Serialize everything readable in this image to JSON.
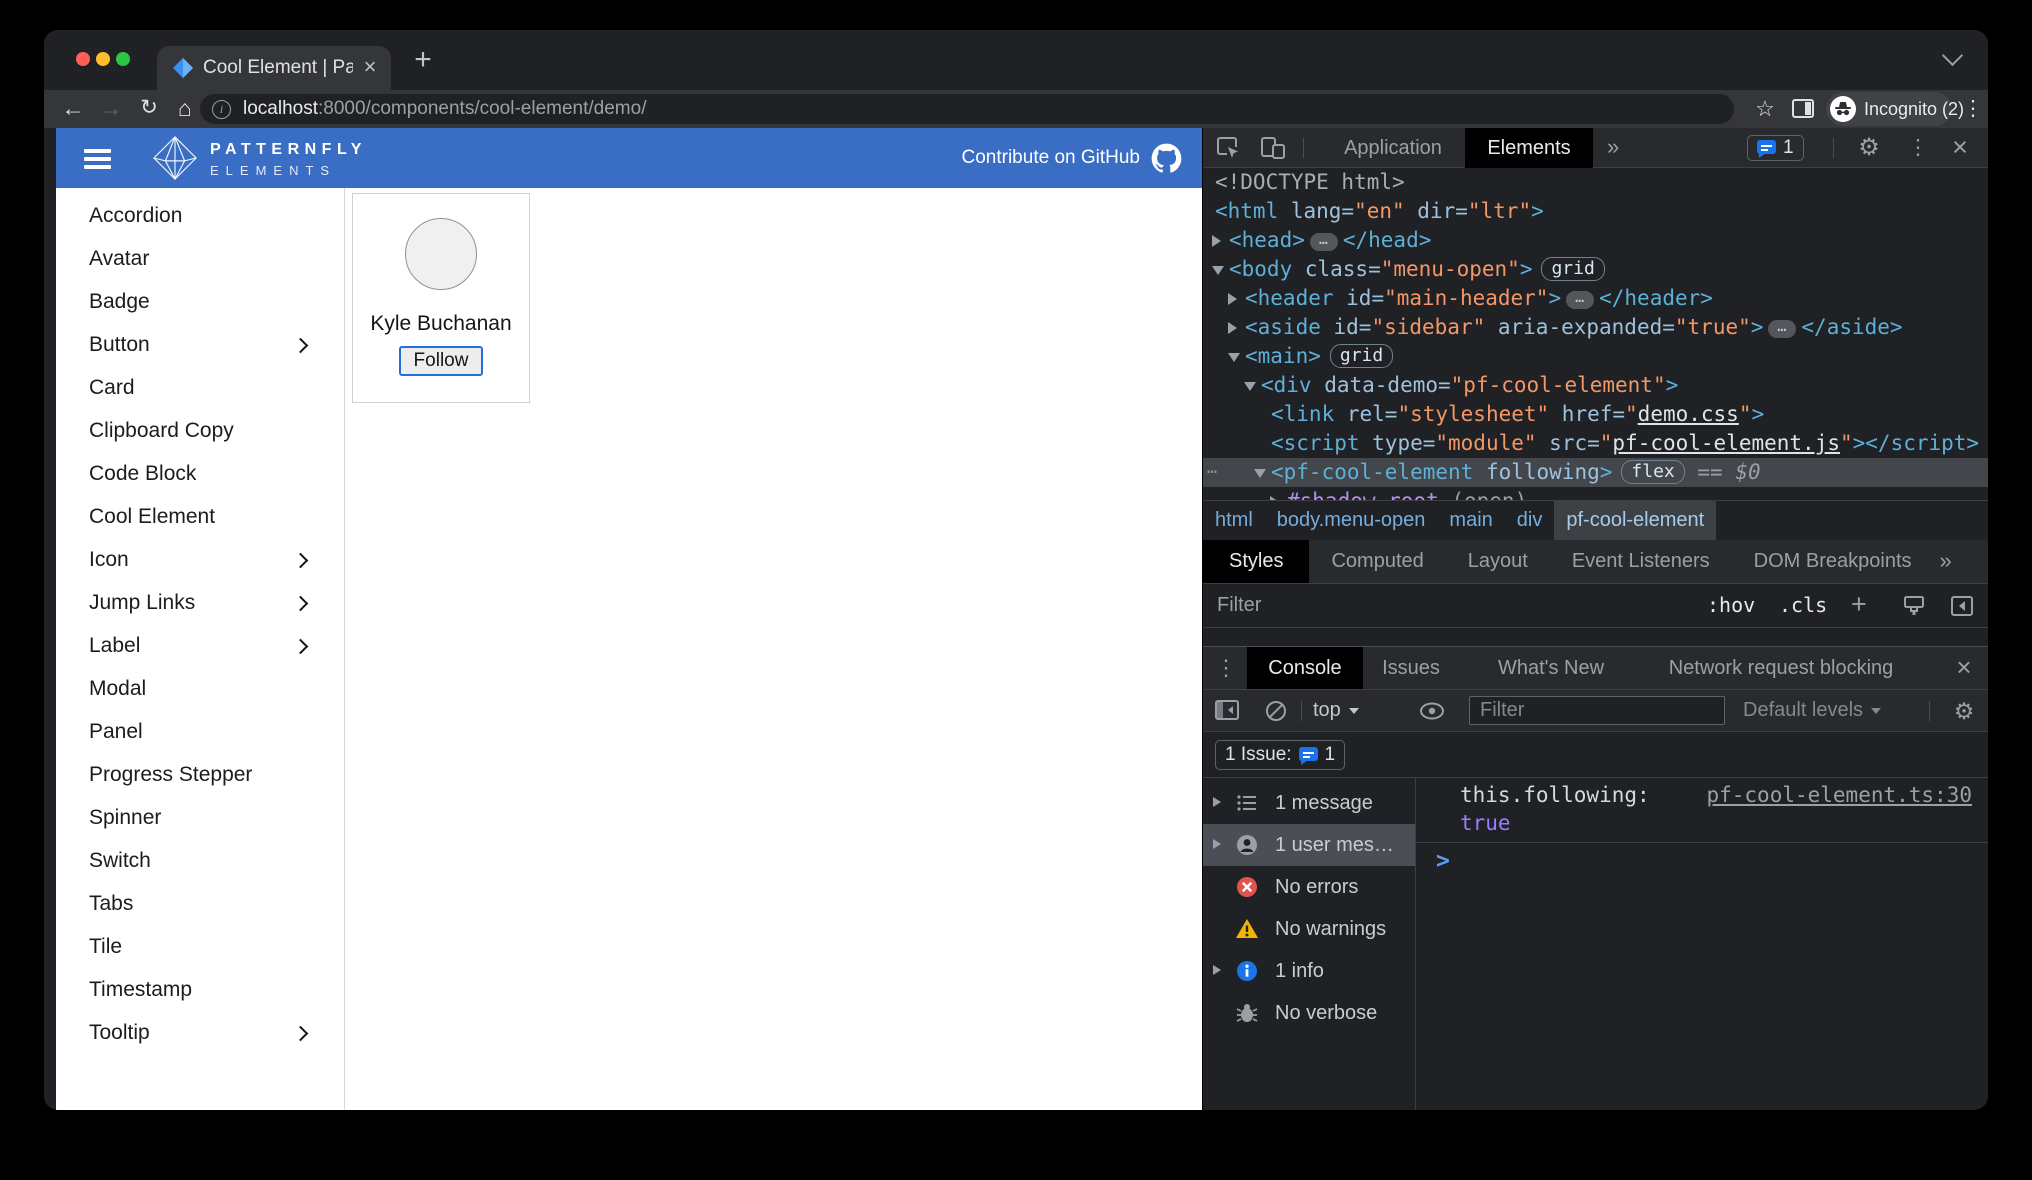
{
  "colors": {
    "brand_blue": "#3a6ec4",
    "devtools_accent_blue": "#1a73e8",
    "follow_button_border_blue": "#2470d8",
    "tag_blue": "#5db0d7",
    "attribute_value_orange": "#f29766",
    "boolean_purple": "#9a7dff",
    "error_red": "#e1544d",
    "warning_yellow": "#f2b400",
    "info_blue": "#1a73e8"
  },
  "glyphs": {
    "plus": "+",
    "back": "←",
    "forward": "→",
    "reload": "↻",
    "home": "⌂",
    "star": "☆",
    "menu_dots": "⋮",
    "more": "»",
    "gear": "⚙",
    "close": "×",
    "drawer_dots": "⋮",
    "prompt": ">",
    "ellipsis_gutter": "⋯"
  },
  "browser": {
    "tab_title": "Cool Element | PatternFly Elem",
    "url_host": "localhost",
    "url_rest": ":8000/components/cool-element/demo/",
    "incognito_label": "Incognito (2)"
  },
  "page": {
    "brand_line1": "PATTERNFLY",
    "brand_line2": "ELEMENTS",
    "github_label": "Contribute on GitHub",
    "sidebar_items": [
      {
        "label": "Accordion",
        "submenu": false
      },
      {
        "label": "Avatar",
        "submenu": false
      },
      {
        "label": "Badge",
        "submenu": false
      },
      {
        "label": "Button",
        "submenu": true
      },
      {
        "label": "Card",
        "submenu": false
      },
      {
        "label": "Clipboard Copy",
        "submenu": false
      },
      {
        "label": "Code Block",
        "submenu": false
      },
      {
        "label": "Cool Element",
        "submenu": false
      },
      {
        "label": "Icon",
        "submenu": true
      },
      {
        "label": "Jump Links",
        "submenu": true
      },
      {
        "label": "Label",
        "submenu": true
      },
      {
        "label": "Modal",
        "submenu": false
      },
      {
        "label": "Panel",
        "submenu": false
      },
      {
        "label": "Progress Stepper",
        "submenu": false
      },
      {
        "label": "Spinner",
        "submenu": false
      },
      {
        "label": "Switch",
        "submenu": false
      },
      {
        "label": "Tabs",
        "submenu": false
      },
      {
        "label": "Tile",
        "submenu": false
      },
      {
        "label": "Timestamp",
        "submenu": false
      },
      {
        "label": "Tooltip",
        "submenu": true
      }
    ],
    "demo_card": {
      "name": "Kyle Buchanan",
      "button": "Follow"
    }
  },
  "devtools": {
    "top_tabs": {
      "inactive": "Application",
      "active": "Elements",
      "issue_count": "1"
    },
    "dom_rows": [
      {
        "pad": 12,
        "seg": [
          {
            "k": "doctype",
            "t": "<!DOCTYPE html>"
          }
        ]
      },
      {
        "pad": 12,
        "seg": [
          {
            "k": "tag",
            "t": "<html"
          },
          {
            "k": "attr",
            "t": " lang="
          },
          {
            "k": "val",
            "t": "\"en\""
          },
          {
            "k": "attr",
            "t": " dir="
          },
          {
            "k": "val",
            "t": "\"ltr\""
          },
          {
            "k": "tag",
            "t": ">"
          }
        ]
      },
      {
        "pad": 26,
        "arrow": "right",
        "seg": [
          {
            "k": "tag",
            "t": "<head>"
          },
          {
            "k": "ellipsis",
            "t": "…"
          },
          {
            "k": "tag",
            "t": "</head>"
          }
        ]
      },
      {
        "pad": 26,
        "arrow": "down",
        "seg": [
          {
            "k": "tag",
            "t": "<body"
          },
          {
            "k": "attr",
            "t": " class="
          },
          {
            "k": "val",
            "t": "\"menu-open\""
          },
          {
            "k": "tag",
            "t": ">"
          },
          {
            "k": "badge",
            "t": "grid"
          }
        ]
      },
      {
        "pad": 42,
        "arrow": "right",
        "seg": [
          {
            "k": "tag",
            "t": "<header"
          },
          {
            "k": "attr",
            "t": " id="
          },
          {
            "k": "val",
            "t": "\"main-header\""
          },
          {
            "k": "tag",
            "t": ">"
          },
          {
            "k": "ellipsis",
            "t": "…"
          },
          {
            "k": "tag",
            "t": "</header>"
          }
        ]
      },
      {
        "pad": 42,
        "arrow": "right",
        "seg": [
          {
            "k": "tag",
            "t": "<aside"
          },
          {
            "k": "attr",
            "t": " id="
          },
          {
            "k": "val",
            "t": "\"sidebar\""
          },
          {
            "k": "attr",
            "t": " aria-expanded="
          },
          {
            "k": "val",
            "t": "\"true\""
          },
          {
            "k": "tag",
            "t": ">"
          },
          {
            "k": "ellipsis",
            "t": "…"
          },
          {
            "k": "tag",
            "t": "</aside>"
          }
        ]
      },
      {
        "pad": 42,
        "arrow": "down",
        "seg": [
          {
            "k": "tag",
            "t": "<main>"
          },
          {
            "k": "badge",
            "t": "grid"
          }
        ]
      },
      {
        "pad": 58,
        "arrow": "down",
        "seg": [
          {
            "k": "tag",
            "t": "<div"
          },
          {
            "k": "attr",
            "t": " data-demo="
          },
          {
            "k": "val",
            "t": "\"pf-cool-element\""
          },
          {
            "k": "tag",
            "t": ">"
          }
        ]
      },
      {
        "pad": 68,
        "seg": [
          {
            "k": "tag",
            "t": "<link"
          },
          {
            "k": "attr",
            "t": " rel="
          },
          {
            "k": "val",
            "t": "\"stylesheet\""
          },
          {
            "k": "attr",
            "t": " href="
          },
          {
            "k": "val",
            "t": "\""
          },
          {
            "k": "vallink",
            "t": "demo.css"
          },
          {
            "k": "val",
            "t": "\""
          },
          {
            "k": "tag",
            "t": ">"
          }
        ]
      },
      {
        "pad": 68,
        "seg": [
          {
            "k": "tag",
            "t": "<script"
          },
          {
            "k": "attr",
            "t": " type="
          },
          {
            "k": "val",
            "t": "\"module\""
          },
          {
            "k": "attr",
            "t": " src="
          },
          {
            "k": "val",
            "t": "\""
          },
          {
            "k": "vallink",
            "t": "pf-cool-element.js"
          },
          {
            "k": "val",
            "t": "\""
          },
          {
            "k": "tag",
            "t": "></script>"
          }
        ]
      },
      {
        "pad": 68,
        "arrow": "down",
        "selected": true,
        "gutter": true,
        "seg": [
          {
            "k": "tag",
            "t": "<pf-cool-element"
          },
          {
            "k": "attr",
            "t": " following"
          },
          {
            "k": "tag",
            "t": ">"
          },
          {
            "k": "badge",
            "t": "flex"
          },
          {
            "k": "eq",
            "t": " == "
          },
          {
            "k": "dollar",
            "t": "$0"
          }
        ]
      },
      {
        "pad": 84,
        "arrow": "right",
        "seg": [
          {
            "k": "shadow",
            "t": "#shadow-root"
          },
          {
            "k": "plain",
            "t": " (open)"
          }
        ]
      }
    ],
    "breadcrumbs": [
      {
        "label": "html",
        "active": false
      },
      {
        "label": "body.menu-open",
        "active": false
      },
      {
        "label": "main",
        "active": false
      },
      {
        "label": "div",
        "active": false
      },
      {
        "label": "pf-cool-element",
        "active": true
      }
    ],
    "styles_tabs": [
      "Styles",
      "Computed",
      "Layout",
      "Event Listeners",
      "DOM Breakpoints"
    ],
    "styles_tabs_active": "Styles",
    "styles_more": "»",
    "styles_filter_placeholder": "Filter",
    "styles_toggles": {
      "hover": ":hov",
      "class": ".cls"
    },
    "console": {
      "tabs": [
        "Console",
        "Issues",
        "What's New",
        "Network request blocking"
      ],
      "active_tab": "Console",
      "context_label": "top",
      "filter_placeholder": "Filter",
      "levels_label": "Default levels",
      "issue_summary": "1 Issue:",
      "issue_count": "1",
      "sidebar": [
        {
          "icon": "list",
          "label": "1 message",
          "expandable": true,
          "selected": false
        },
        {
          "icon": "user",
          "label": "1 user mes…",
          "expandable": true,
          "selected": true
        },
        {
          "icon": "error",
          "label": "No errors",
          "expandable": false,
          "selected": false
        },
        {
          "icon": "warning",
          "label": "No warnings",
          "expandable": false,
          "selected": false
        },
        {
          "icon": "info",
          "label": "1 info",
          "expandable": true,
          "selected": false
        },
        {
          "icon": "verbose",
          "label": "No verbose",
          "expandable": false,
          "selected": false
        }
      ],
      "message": {
        "line1": "this.following:",
        "line2": "true",
        "source": "pf-cool-element.ts:30"
      }
    }
  }
}
